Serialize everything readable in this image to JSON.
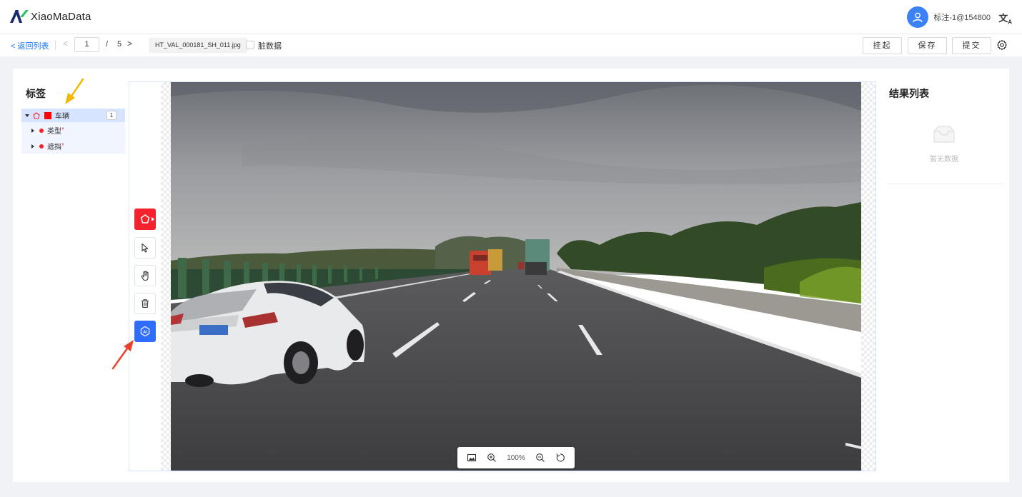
{
  "header": {
    "app_name": "XiaoMaData",
    "user_name": "标注-1@154800",
    "lang_icon": "translate-icon"
  },
  "toolbar": {
    "back_label": "< 返回列表",
    "current_page": "1",
    "page_separator": "/",
    "total_pages": "5",
    "filename": "HT_VAL_000181_SH_011.jpg",
    "dirty_label": "脏数据",
    "suspend_label": "挂起",
    "save_label": "保存",
    "submit_label": "提交"
  },
  "labels_panel": {
    "title": "标签",
    "tree": [
      {
        "name": "车辆",
        "count": "1",
        "color": "#ff0000",
        "expanded": true
      },
      {
        "name": "类型",
        "required_mark": "*"
      },
      {
        "name": "遮挡",
        "required_mark": "*"
      }
    ]
  },
  "tools": [
    "polygon-tool",
    "select-tool",
    "pan-tool",
    "delete-tool",
    "ai-tool"
  ],
  "zoom": {
    "value": "100%"
  },
  "results_panel": {
    "title": "结果列表",
    "empty_text": "暂无数据"
  },
  "colors": {
    "accent": "#1677ff",
    "tool_active": "#f5222d",
    "ai_button": "#2f6dff",
    "annotation_arrow_yellow": "#f5b800",
    "annotation_arrow_red": "#e8412c"
  }
}
